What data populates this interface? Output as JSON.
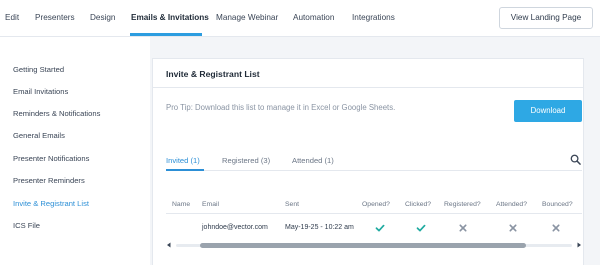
{
  "nav": {
    "tabs": [
      {
        "label": "Edit"
      },
      {
        "label": "Presenters"
      },
      {
        "label": "Design"
      },
      {
        "label": "Emails & Invitations",
        "active": true
      },
      {
        "label": "Manage Webinar"
      },
      {
        "label": "Automation"
      },
      {
        "label": "Integrations"
      }
    ],
    "landing_button": "View Landing Page"
  },
  "sidebar": {
    "items": [
      {
        "label": "Getting Started"
      },
      {
        "label": "Email Invitations"
      },
      {
        "label": "Reminders & Notifications"
      },
      {
        "label": "General Emails"
      },
      {
        "label": "Presenter Notifications"
      },
      {
        "label": "Presenter Reminders"
      },
      {
        "label": "Invite & Registrant List",
        "active": true
      },
      {
        "label": "ICS File"
      }
    ]
  },
  "panel": {
    "title": "Invite & Registrant List",
    "pro_tip": "Pro Tip: Download this list to manage it in Excel or Google Sheets.",
    "download_button": "Download",
    "subtabs": [
      {
        "label": "Invited (1)",
        "active": true
      },
      {
        "label": "Registered (3)"
      },
      {
        "label": "Attended (1)"
      }
    ],
    "table": {
      "columns": [
        "Name",
        "Email",
        "Sent",
        "Opened?",
        "Clicked?",
        "Registered?",
        "Attended?",
        "Bounced?"
      ],
      "rows": [
        {
          "name": "",
          "email": "johndoe@vector.com",
          "sent": "May-19-25 - 10:22 am",
          "opened": "check-icon",
          "clicked": "check-icon",
          "registered": "x-icon",
          "attended": "x-icon",
          "bounced": "x-icon"
        }
      ]
    }
  },
  "colors": {
    "accent": "#2c8fd6",
    "download_button": "#2ea8e4",
    "check": "#1eaaa0",
    "x_mark": "#8a94a3",
    "main_background": "#f3f5f8"
  }
}
